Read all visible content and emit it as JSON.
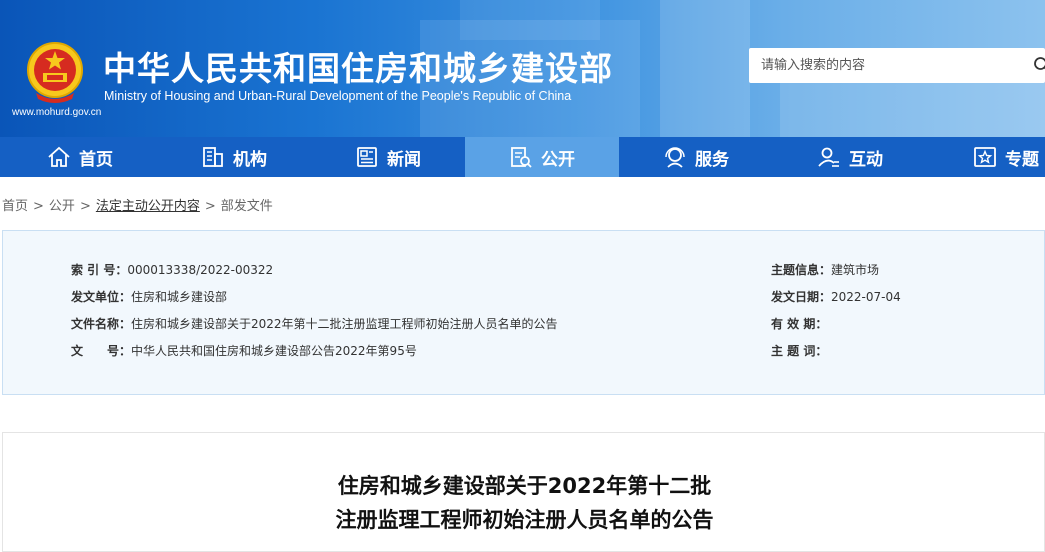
{
  "header": {
    "title": "中华人民共和国住房和城乡建设部",
    "subtitle": "Ministry of Housing and Urban-Rural Development of the People's Republic of China",
    "url": "www.mohurd.gov.cn",
    "emblem_icon": "national-emblem-icon"
  },
  "search": {
    "placeholder": "请输入搜索的内容",
    "icon": "search-icon"
  },
  "nav": {
    "items": [
      {
        "label": "首页",
        "icon": "home-icon"
      },
      {
        "label": "机构",
        "icon": "building-icon"
      },
      {
        "label": "新闻",
        "icon": "news-icon"
      },
      {
        "label": "公开",
        "icon": "document-icon",
        "active": true
      },
      {
        "label": "服务",
        "icon": "service-icon"
      },
      {
        "label": "互动",
        "icon": "user-chat-icon"
      },
      {
        "label": "专题",
        "icon": "star-icon"
      }
    ],
    "active_color": "#5aa2e6",
    "bar_color": "#1560c4"
  },
  "breadcrumb": {
    "items": [
      "首页",
      "公开",
      "法定主动公开内容",
      "部发文件"
    ],
    "separator": ">"
  },
  "info": {
    "index_label": "索 引 号：",
    "index_value": "000013338/2022-00322",
    "topic_label": "主题信息：",
    "topic_value": "建筑市场",
    "issuer_label": "发文单位：",
    "issuer_value": "住房和城乡建设部",
    "date_label": "发文日期：",
    "date_value": "2022-07-04",
    "name_label": "文件名称：",
    "name_value": "住房和城乡建设部关于2022年第十二批注册监理工程师初始注册人员名单的公告",
    "validity_label": "有 效 期：",
    "validity_value": "",
    "docno_label": "文　　号：",
    "docno_value": "中华人民共和国住房和城乡建设部公告2022年第95号",
    "keywords_label": "主 题 词：",
    "keywords_value": ""
  },
  "article": {
    "title_line1": "住房和城乡建设部关于2022年第十二批",
    "title_line2": "注册监理工程师初始注册人员名单的公告"
  }
}
